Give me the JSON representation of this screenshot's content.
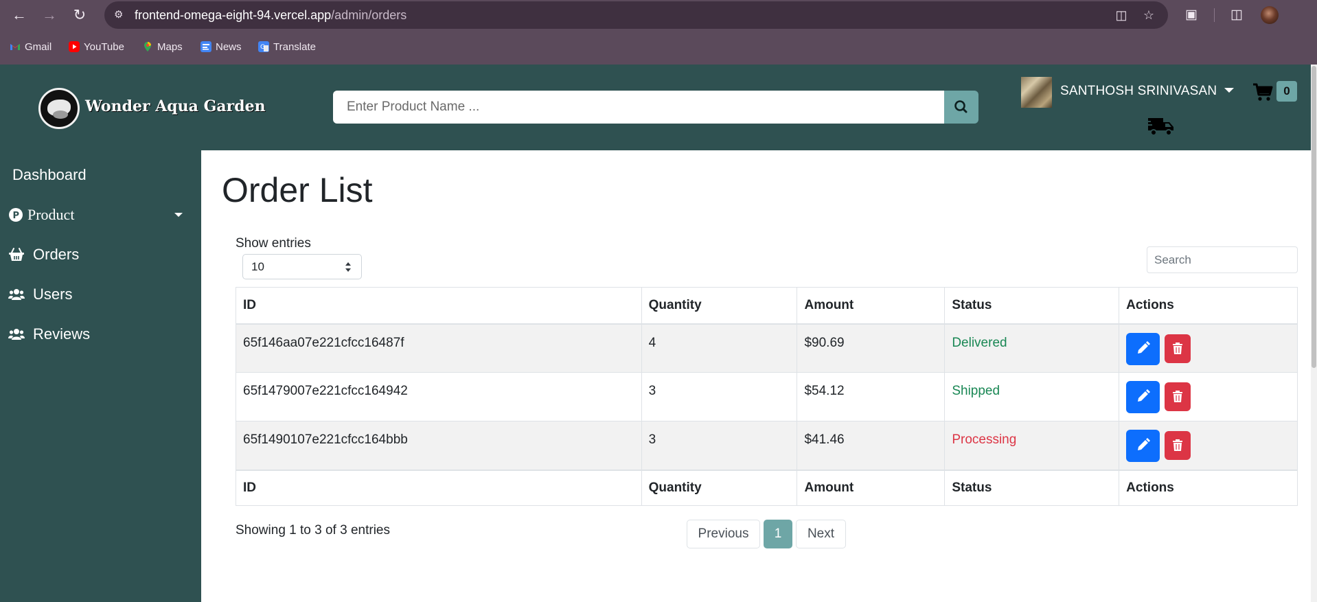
{
  "browser": {
    "url_host": "frontend-omega-eight-94.vercel.app",
    "url_path": "/admin/orders",
    "bookmarks": [
      {
        "label": "Gmail",
        "icon": "gmail-icon",
        "color": "#ea4335"
      },
      {
        "label": "YouTube",
        "icon": "youtube-icon",
        "color": "#ff0000"
      },
      {
        "label": "Maps",
        "icon": "maps-icon",
        "color": "#34a853"
      },
      {
        "label": "News",
        "icon": "news-icon",
        "color": "#4285f4"
      },
      {
        "label": "Translate",
        "icon": "translate-icon",
        "color": "#4285f4"
      }
    ]
  },
  "header": {
    "brand": "Wonder Aqua Garden",
    "search_placeholder": "Enter Product Name ...",
    "user_name": "SANTHOSH SRINIVASAN",
    "cart_count": "0",
    "colors": {
      "header_bg": "#2f5151",
      "accent": "#6ea6a6"
    }
  },
  "sidebar": {
    "items": [
      {
        "label": "Dashboard",
        "icon": ""
      },
      {
        "label": "Product",
        "icon": "product-p-icon"
      },
      {
        "label": "Orders",
        "icon": "basket-icon"
      },
      {
        "label": "Users",
        "icon": "users-icon"
      },
      {
        "label": "Reviews",
        "icon": "users-icon"
      }
    ]
  },
  "main": {
    "title": "Order List",
    "show_entries_label": "Show entries",
    "entries_value": "10",
    "search_placeholder": "Search",
    "columns": [
      "ID",
      "Quantity",
      "Amount",
      "Status",
      "Actions"
    ],
    "rows": [
      {
        "id": "65f146aa07e221cfcc16487f",
        "quantity": "4",
        "amount": "$90.69",
        "status": "Delivered",
        "status_color": "#198754"
      },
      {
        "id": "65f1479007e221cfcc164942",
        "quantity": "3",
        "amount": "$54.12",
        "status": "Shipped",
        "status_color": "#198754"
      },
      {
        "id": "65f1490107e221cfcc164bbb",
        "quantity": "3",
        "amount": "$41.46",
        "status": "Processing",
        "status_color": "#dc3545"
      }
    ],
    "showing_text": "Showing 1 to 3 of 3 entries",
    "pagination": {
      "previous": "Previous",
      "current": "1",
      "next": "Next"
    }
  }
}
